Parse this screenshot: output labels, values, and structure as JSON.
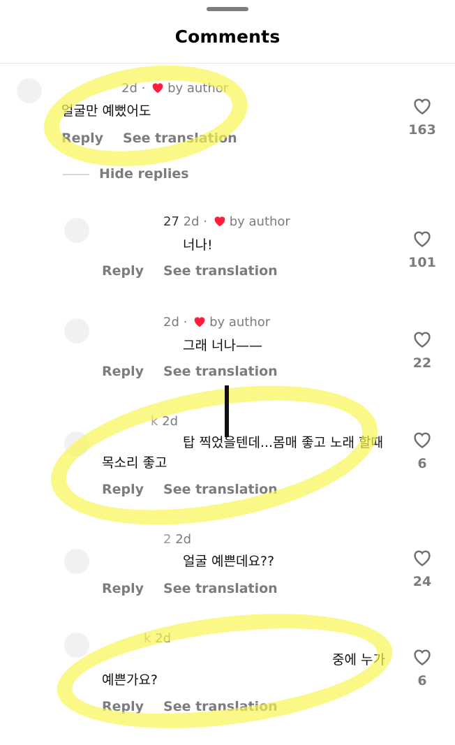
{
  "header": {
    "title": "Comments"
  },
  "hide_replies_label": "Hide replies",
  "comments": [
    {
      "username": "",
      "time": "2d",
      "author_tag": "by author",
      "text": "얼굴만 예뻤어도",
      "reply_label": "Reply",
      "translate_label": "See translation",
      "likes": "163"
    },
    {
      "username": "27",
      "time": "2d",
      "author_tag": "by author",
      "text": "너나!",
      "reply_label": "Reply",
      "translate_label": "See translation",
      "likes": "101"
    },
    {
      "username": "",
      "time": "2d",
      "author_tag": "by author",
      "text": "그래 너나——",
      "reply_label": "Reply",
      "translate_label": "See translation",
      "likes": "22"
    },
    {
      "username": "k",
      "time": "2d",
      "text": "탑 찍었을텐데...몸매 좋고 노래 할때 목소리 좋고",
      "reply_label": "Reply",
      "translate_label": "See translation",
      "likes": "6"
    },
    {
      "username": "2",
      "time": "2d",
      "text": "얼굴 예쁜데요??",
      "reply_label": "Reply",
      "translate_label": "See translation",
      "likes": "24"
    },
    {
      "username": "k",
      "time": "2d",
      "text": "중에 누가 예쁜가요?",
      "reply_label": "Reply",
      "translate_label": "See translation",
      "likes": "6"
    }
  ],
  "colors": {
    "heart_red": "#ff1f3d",
    "highlight_yellow": "#f8f650",
    "muted_text": "#7b7b80"
  },
  "icons": {
    "like": "heart-outline-icon",
    "author_like": "heart-filled-icon"
  }
}
